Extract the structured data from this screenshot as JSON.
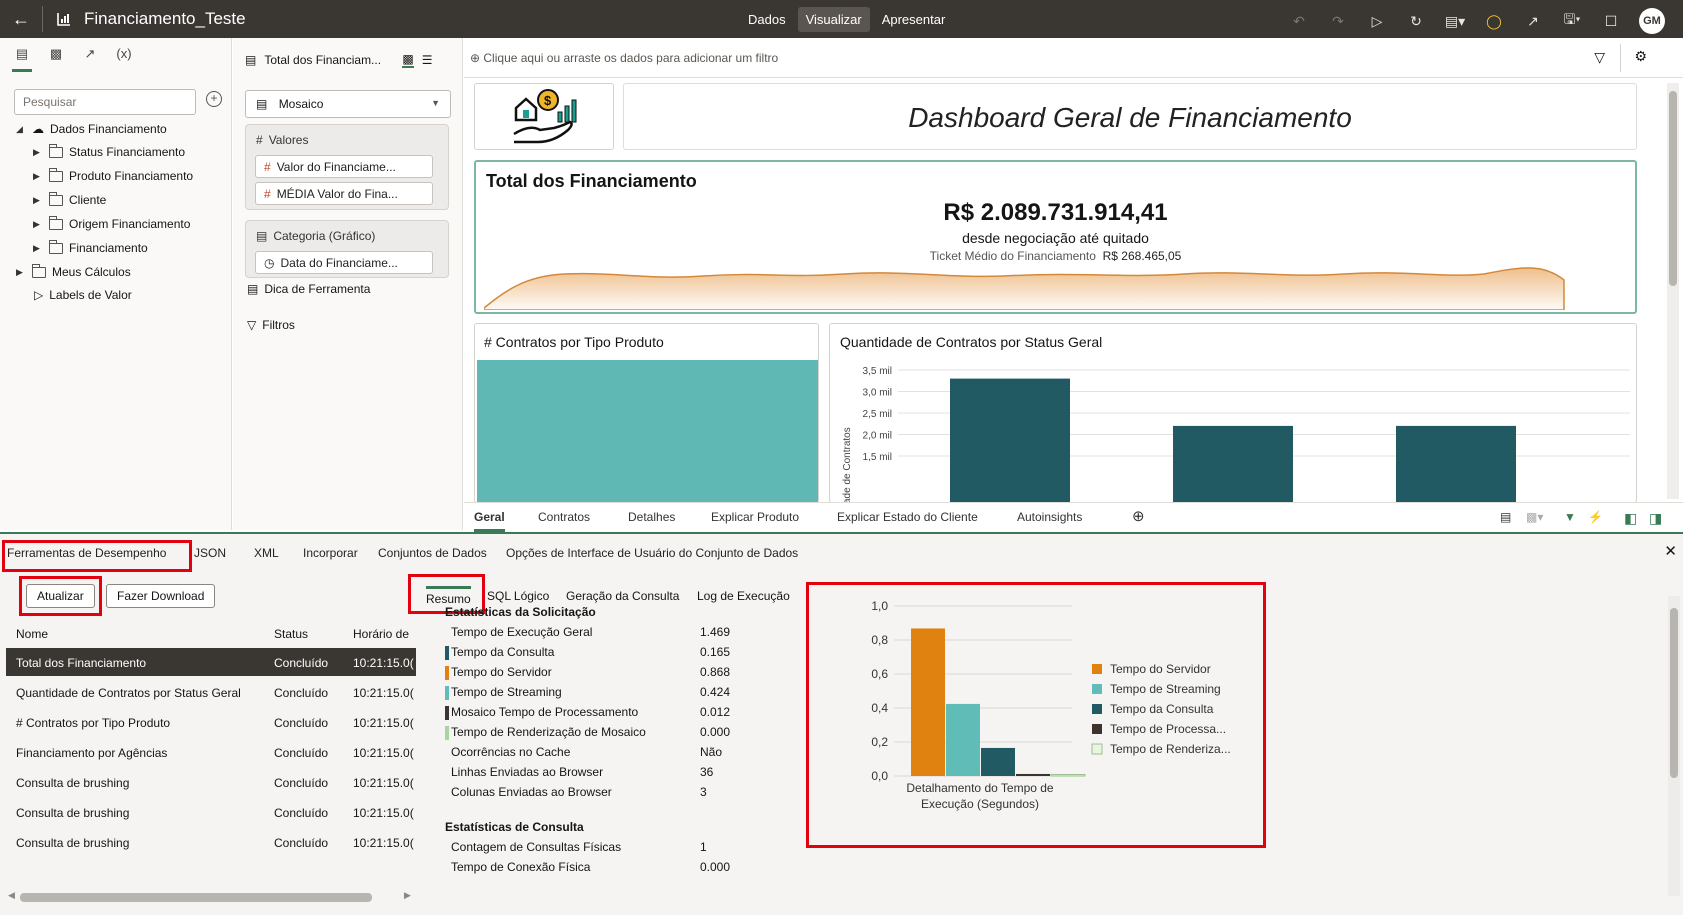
{
  "window": {
    "title": "Financiamento_Teste",
    "modes": [
      "Dados",
      "Visualizar",
      "Apresentar"
    ],
    "active_mode": "Visualizar",
    "avatar": "GM"
  },
  "data_panel": {
    "search_placeholder": "Pesquisar",
    "root": "Dados Financiamento",
    "folders": [
      "Status Financiamento",
      "Produto Financiamento",
      "Cliente",
      "Origem Financiamento",
      "Financiamento"
    ],
    "my_calcs": "Meus Cálculos",
    "value_labels": "Labels de Valor"
  },
  "grammar_panel": {
    "viz_name": "Total dos Financiam...",
    "viz_type": "Mosaico",
    "values_label": "Valores",
    "values": [
      "Valor do Financiame...",
      "MÉDIA Valor do Fina..."
    ],
    "category_label": "Categoria (Gráfico)",
    "category_values": [
      "Data do Financiame..."
    ],
    "tooltip_label": "Dica de Ferramenta",
    "filters_label": "Filtros"
  },
  "canvas": {
    "filter_hint": "Clique aqui ou arraste os dados para adicionar um filtro",
    "dashboard_title": "Dashboard Geral de Financiamento",
    "total_card": {
      "title": "Total dos Financiamento",
      "value": "R$ 2.089.731.914,41",
      "subtitle": "desde negociação até quitado",
      "ticket_label": "Ticket Médio do Financiamento",
      "ticket_value": "R$ 268.465,05"
    },
    "contracts_by_product_title": "# Contratos por Tipo Produto",
    "status_chart": {
      "title": "Quantidade de Contratos por Status Geral",
      "ylabel": "ade de Contratos",
      "ticks": [
        "3,5 mil",
        "3,0 mil",
        "2,5 mil",
        "2,0 mil",
        "1,5 mil"
      ],
      "bar_values": [
        3.3,
        2.2,
        2.2
      ],
      "y_min": 1.3,
      "y_max": 3.5,
      "bar_color": "#215a63"
    },
    "tabs": [
      "Geral",
      "Contratos",
      "Detalhes",
      "Explicar Produto",
      "Explicar Estado do Cliente",
      "Autoinsights"
    ],
    "active_tab": "Geral"
  },
  "perf": {
    "top_tabs": [
      "Ferramentas de Desempenho",
      "JSON",
      "XML",
      "Incorporar",
      "Conjuntos de Dados",
      "Opções de Interface de Usuário do Conjunto de Dados"
    ],
    "refresh_label": "Atualizar",
    "download_label": "Fazer Download",
    "columns": [
      "Nome",
      "Status",
      "Horário de"
    ],
    "rows": [
      {
        "name": "Total dos Financiamento",
        "status": "Concluído",
        "time": "10:21:15.0("
      },
      {
        "name": "Quantidade de Contratos por Status Geral",
        "status": "Concluído",
        "time": "10:21:15.0("
      },
      {
        "name": "# Contratos por Tipo Produto",
        "status": "Concluído",
        "time": "10:21:15.0("
      },
      {
        "name": "Financiamento por Agências",
        "status": "Concluído",
        "time": "10:21:15.0("
      },
      {
        "name": "Consulta de brushing",
        "status": "Concluído",
        "time": "10:21:15.0("
      },
      {
        "name": "Consulta de brushing",
        "status": "Concluído",
        "time": "10:21:15.0("
      },
      {
        "name": "Consulta de brushing",
        "status": "Concluído",
        "time": "10:21:15.0("
      }
    ],
    "detail_tabs": [
      "Resumo",
      "SQL Lógico",
      "Geração da Consulta",
      "Log de Execução"
    ],
    "request_stats_title": "Estatísticas da Solicitação",
    "request_stats": [
      {
        "label": "Tempo de Execução Geral",
        "value": "1.469",
        "color": ""
      },
      {
        "label": "Tempo da Consulta",
        "value": "0.165",
        "color": "#215a63"
      },
      {
        "label": "Tempo do Servidor",
        "value": "0.868",
        "color": "#e0820f"
      },
      {
        "label": "Tempo de Streaming",
        "value": "0.424",
        "color": "#5fbcb7"
      },
      {
        "label": "Mosaico Tempo de Processamento",
        "value": "0.012",
        "color": "#3d3430"
      },
      {
        "label": "Tempo de Renderização de Mosaico",
        "value": "0.000",
        "color": "#a6d5a0"
      },
      {
        "label": "Ocorrências no Cache",
        "value": "Não",
        "color": ""
      },
      {
        "label": "Linhas Enviadas ao Browser",
        "value": "36",
        "color": ""
      },
      {
        "label": "Colunas Enviadas ao Browser",
        "value": "3",
        "color": ""
      }
    ],
    "query_stats_title": "Estatísticas de Consulta",
    "query_stats": [
      {
        "label": "Contagem de Consultas Físicas",
        "value": "1"
      },
      {
        "label": "Tempo de Conexão Física",
        "value": "0.000"
      }
    ]
  },
  "chart_data": {
    "type": "bar",
    "xlabel": "Detalhamento do Tempo de Execução (Segundos)",
    "ylim": [
      0,
      1.0
    ],
    "yticks": [
      "1,0",
      "0,8",
      "0,6",
      "0,4",
      "0,2",
      "0,0"
    ],
    "series": [
      {
        "name": "Tempo do Servidor",
        "values": [
          0.868
        ],
        "color": "#e0820f"
      },
      {
        "name": "Tempo de Streaming",
        "values": [
          0.424
        ],
        "color": "#5fbcb7"
      },
      {
        "name": "Tempo da Consulta",
        "values": [
          0.165
        ],
        "color": "#215a63"
      },
      {
        "name": "Tempo de Processa...",
        "values": [
          0.012
        ],
        "color": "#3d3430"
      },
      {
        "name": "Tempo de Renderiza...",
        "values": [
          0.0
        ],
        "color": "#e8f5e0"
      }
    ],
    "legend": "right"
  }
}
